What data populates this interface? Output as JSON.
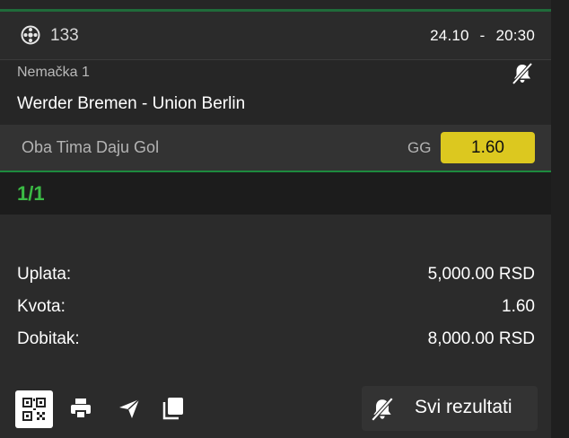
{
  "match": {
    "id": "133",
    "date": "24.10",
    "time": "20:30",
    "datetime_sep": "-",
    "league": "Nemačka 1",
    "teams": "Werder Bremen - Union Berlin"
  },
  "bet": {
    "name": "Oba Tima Daju Gol",
    "code": "GG",
    "odd": "1.60"
  },
  "ticket": {
    "count": "1/1",
    "stake_label": "Uplata:",
    "stake_value": "5,000.00 RSD",
    "odds_label": "Kvota:",
    "odds_value": "1.60",
    "win_label": "Dobitak:",
    "win_value": "8,000.00 RSD"
  },
  "toolbar": {
    "results_label": "Svi rezultati",
    "icons": [
      "qr-code-icon",
      "print-icon",
      "send-icon",
      "copy-icon",
      "bell-off-icon"
    ]
  },
  "colors": {
    "accent_green": "#3bbb45",
    "odd_yellow": "#dcc81f",
    "background": "#2b2b2b"
  }
}
